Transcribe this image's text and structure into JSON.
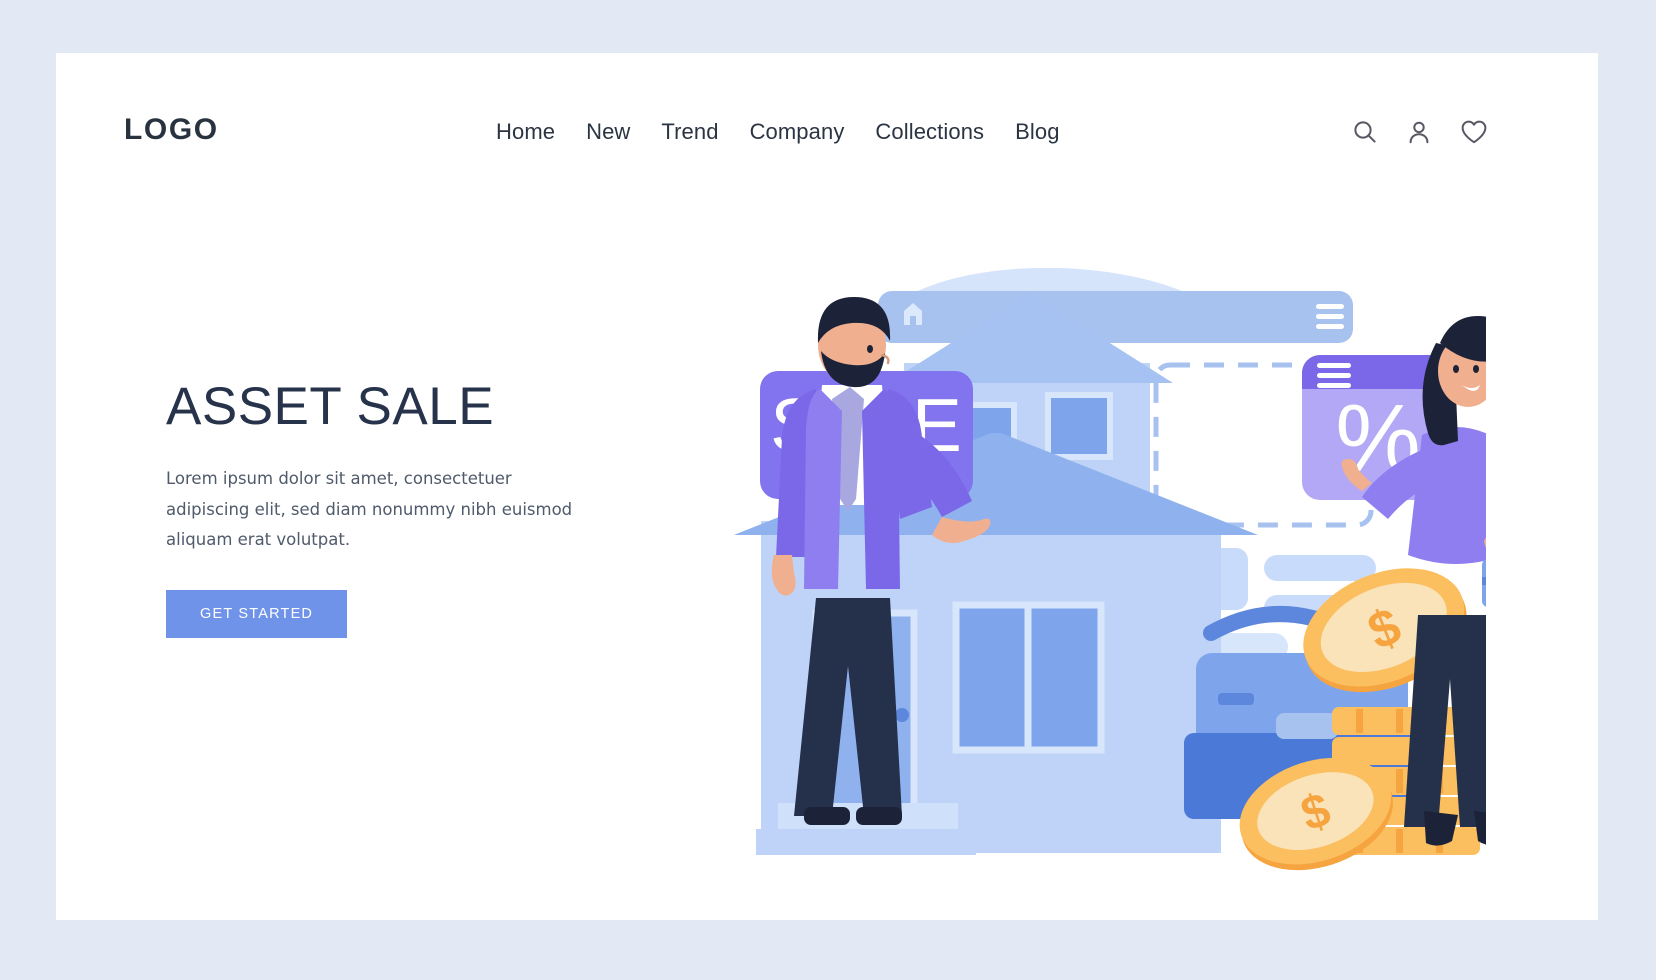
{
  "theme": {
    "page_bg": "#e3e8f5",
    "card_bg": "#ffffff",
    "text_dark": "#26334a",
    "nav_text": "#2b3442",
    "body_text": "#4f5a6b",
    "cta_bg": "#6f93e8",
    "cta_text": "#ffffff",
    "accent_purple": "#8273ef",
    "accent_purple_light": "#b3a8f5",
    "accent_blue": "#6d8fe8",
    "accent_blue_light": "#a8c2f0",
    "accent_blue_pale": "#c8dbfa",
    "coin_gold": "#fbbf5f",
    "coin_gold_light": "#fae3b8",
    "icon_gray": "#5a5663"
  },
  "header": {
    "logo": "LOGO",
    "nav": [
      {
        "label": "Home"
      },
      {
        "label": "New"
      },
      {
        "label": "Trend"
      },
      {
        "label": "Company"
      },
      {
        "label": "Collections"
      },
      {
        "label": "Blog"
      }
    ],
    "icons": [
      {
        "name": "search-icon",
        "label": "Search"
      },
      {
        "name": "user-icon",
        "label": "Account"
      },
      {
        "name": "heart-icon",
        "label": "Favorites"
      }
    ]
  },
  "hero": {
    "title": "ASSET SALE",
    "paragraph": "Lorem ipsum dolor sit amet, consectetuer adipiscing elit, sed diam nonummy nibh euismod aliquam erat volutpat.",
    "cta_label": "GET STARTED"
  },
  "illustration": {
    "sale_badge": "SALE",
    "percent_badge": "%",
    "browser_home_icon": "home-icon",
    "browser_menu_icon": "hamburger-menu-icon",
    "card_menu_icon": "hamburger-menu-icon",
    "coin_symbol": "$",
    "characters": [
      {
        "name": "man-presenting",
        "description": "man in purple jacket with tie gesturing"
      },
      {
        "name": "woman-with-briefcase",
        "description": "woman in purple top holding a briefcase"
      }
    ],
    "objects": [
      {
        "name": "house"
      },
      {
        "name": "briefcase"
      },
      {
        "name": "coin-stack"
      },
      {
        "name": "browser-window"
      }
    ]
  }
}
